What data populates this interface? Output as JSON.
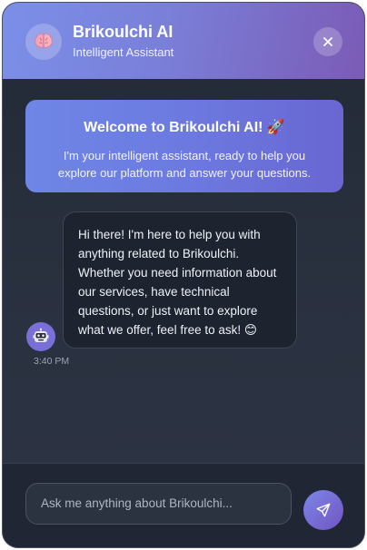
{
  "header": {
    "title": "Brikoulchi AI",
    "subtitle": "Intelligent Assistant",
    "avatar_icon": "brain-icon",
    "close_icon": "close-icon"
  },
  "welcome": {
    "title": "Welcome to Brikoulchi AI! 🚀",
    "text": "I'm your intelligent assistant, ready to help you explore our platform and answer your questions."
  },
  "messages": [
    {
      "sender": "bot",
      "avatar_icon": "robot-icon",
      "text": "Hi there! I'm here to help you with anything related to Brikoulchi. Whether you need information about our services, have technical questions, or just want to explore what we offer, feel free to ask! 😊",
      "time": "3:40 PM"
    }
  ],
  "input": {
    "placeholder": "Ask me anything about Brikoulchi...",
    "send_icon": "send-icon"
  },
  "colors": {
    "header_start": "#7b8fe8",
    "header_end": "#7b5bb6",
    "welcome_start": "#6f86e6",
    "welcome_end": "#6a66d2",
    "panel_bg": "#232a36",
    "bubble_bg": "#1d2430",
    "send_button": "#7255c3"
  }
}
